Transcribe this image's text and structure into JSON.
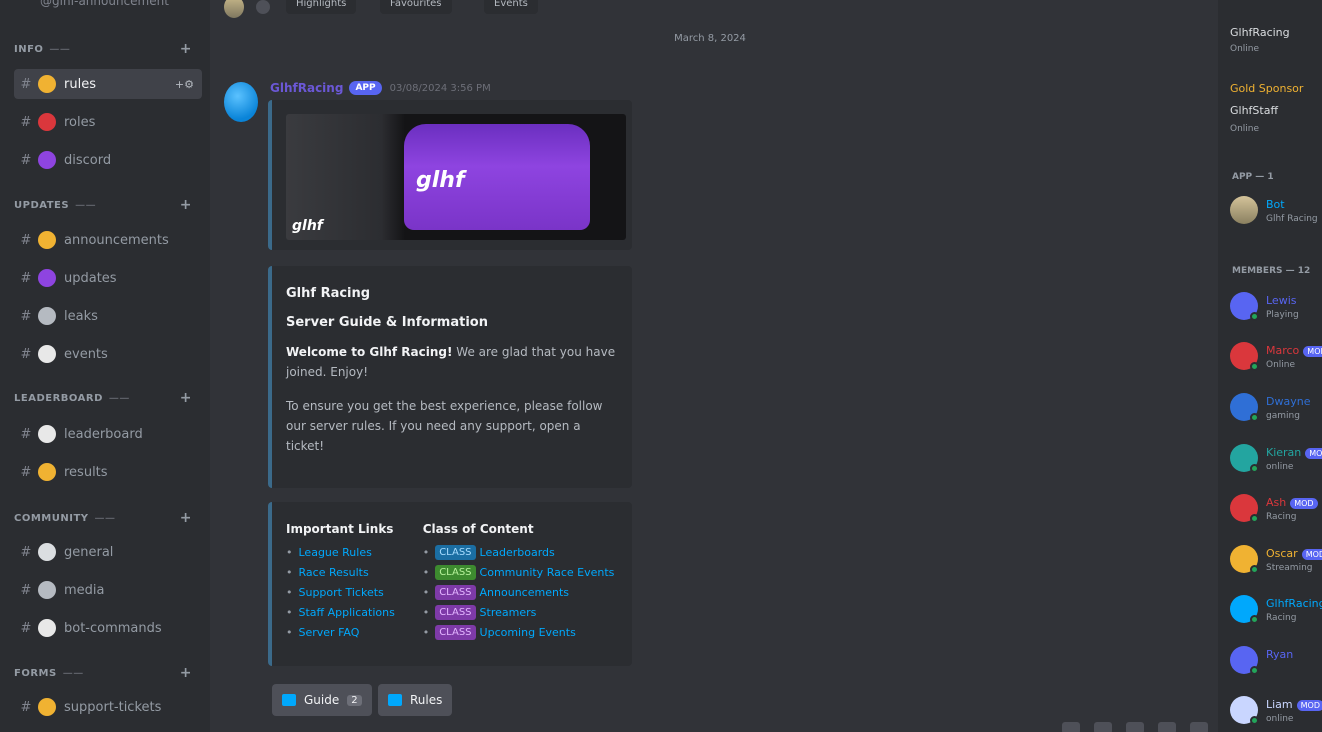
{
  "sidebar": {
    "top_item": "@glhf-announcement",
    "categories": [
      {
        "label": "INFO"
      },
      {
        "label": "UPDATES"
      },
      {
        "label": "LEADERBOARD"
      },
      {
        "label": "COMMUNITY"
      },
      {
        "label": "FORMS"
      }
    ],
    "channels": [
      {
        "label": "rules",
        "color": "#f0b232"
      },
      {
        "label": "roles",
        "color": "#da373c"
      },
      {
        "label": "discord",
        "color": "#8e44e0"
      },
      {
        "label": "announcements",
        "color": "#f0b232"
      },
      {
        "label": "updates",
        "color": "#8e44e0"
      },
      {
        "label": "leaks",
        "color": "#b5bac1"
      },
      {
        "label": "events",
        "color": "#e8e8e8"
      },
      {
        "label": "leaderboard",
        "color": "#e8e8e8"
      },
      {
        "label": "results",
        "color": "#f0b232"
      },
      {
        "label": "general",
        "color": "#dbdee1"
      },
      {
        "label": "media",
        "color": "#b5bac1"
      },
      {
        "label": "bot-commands",
        "color": "#e8e8e8"
      },
      {
        "label": "support-tickets",
        "color": "#f0b232"
      }
    ],
    "active_actions": "+⚙"
  },
  "topbar": {
    "pills": [
      "Highlights",
      "Favourites",
      "Events"
    ]
  },
  "chat": {
    "date_divider": "March 8, 2024",
    "message": {
      "author": "GlhfRacing",
      "bot_tag": "APP",
      "timestamp": "03/08/2024 3:56 PM"
    },
    "banner": {
      "car_text": "glhf",
      "corner_logo": "glhf"
    },
    "embed": {
      "title": "Glhf Racing",
      "subtitle": "Server Guide & Information",
      "p1_bold": "Welcome to Glhf Racing!",
      "p1_rest": " We are glad that you have joined. Enjoy!",
      "p2": "To ensure you get the best experience, please follow our server rules. If you need any support, open a ticket!",
      "col1_title": "Important Links",
      "col1_links": [
        "League Rules",
        "Race Results",
        "Support Tickets",
        "Staff Applications",
        "Server FAQ"
      ],
      "col2_title": "Class of Content",
      "col2_items": [
        {
          "chip": "CLASS",
          "label": "Leaderboards",
          "color": "blue"
        },
        {
          "chip": "CLASS",
          "label": "Community Race Events",
          "color": "green"
        },
        {
          "chip": "CLASS",
          "label": "Announcements",
          "color": "purple"
        },
        {
          "chip": "CLASS",
          "label": "Streamers",
          "color": "purple"
        },
        {
          "chip": "CLASS",
          "label": "Upcoming Events",
          "color": "purple"
        }
      ]
    },
    "buttons": [
      {
        "label": "Guide",
        "count": "2"
      },
      {
        "label": "Rules"
      }
    ]
  },
  "members": {
    "top1_name": "GlhfRacing",
    "top1_sub": "Online",
    "top2_name": "Gold Sponsor",
    "top2_name2": "GlhfStaff",
    "top2_sub": "Online",
    "categories": [
      "APP — 1",
      "MEMBERS — 12"
    ],
    "app_member": {
      "name": "Bot",
      "sub": "Glhf Racing"
    },
    "list": [
      {
        "name": "Lewis",
        "sub": "Playing",
        "color": "#5865f2",
        "tag": ""
      },
      {
        "name": "Marco",
        "sub": "Online",
        "color": "#da373c",
        "tag": "MOD"
      },
      {
        "name": "Dwayne",
        "sub": "gaming",
        "color": "#2f6fd6",
        "tag": ""
      },
      {
        "name": "Kieran",
        "sub": "online",
        "color": "#23a5a0",
        "tag": "MOD"
      },
      {
        "name": "Ash",
        "sub": "Racing",
        "color": "#da373c",
        "tag": "MOD"
      },
      {
        "name": "Oscar",
        "sub": "Streaming",
        "color": "#f0b232",
        "tag": "MOD"
      },
      {
        "name": "GlhfRacing",
        "sub": "Racing",
        "color": "#00a8fc",
        "tag": ""
      },
      {
        "name": "Ryan",
        "sub": "",
        "color": "#5865f2",
        "tag": ""
      },
      {
        "name": "Liam",
        "sub": "online",
        "color": "#c9d6ff",
        "tag": "MOD"
      }
    ]
  }
}
